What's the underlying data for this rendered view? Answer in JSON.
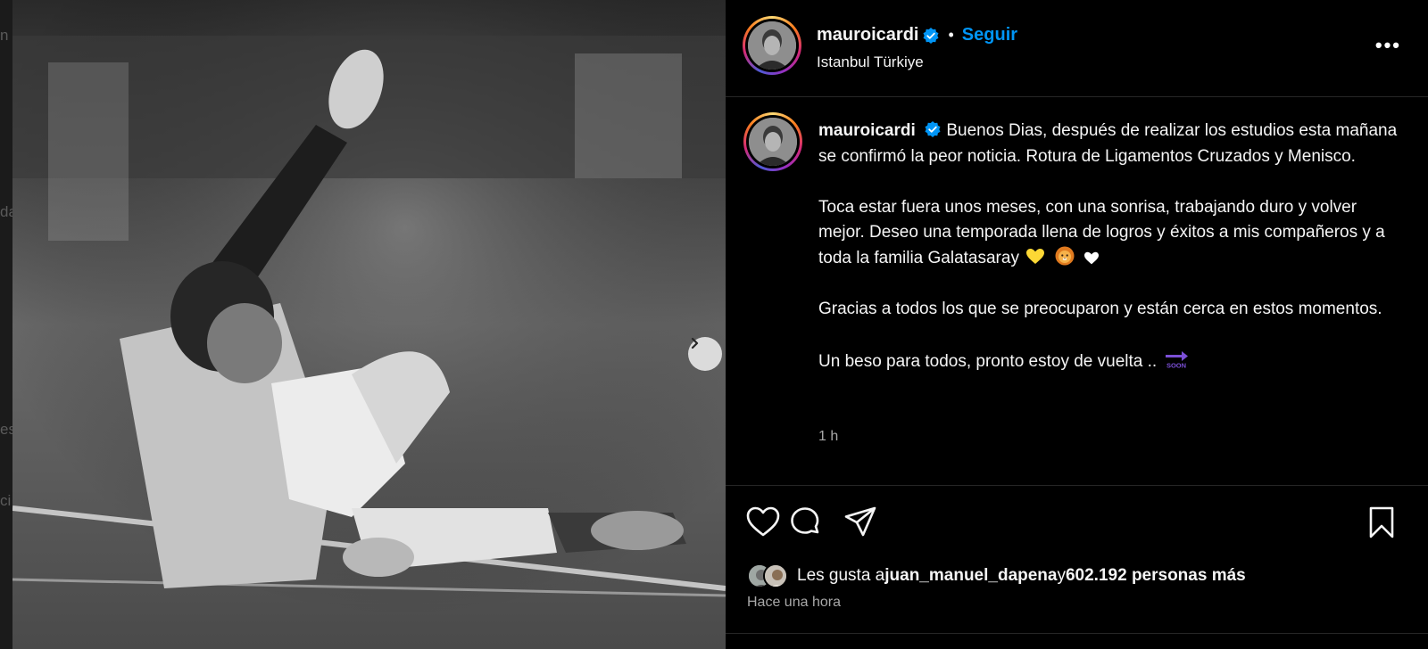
{
  "background_fragments": [
    "n",
    "da",
    "es",
    "ci"
  ],
  "post": {
    "username": "mauroicardi",
    "verified": true,
    "separator": "•",
    "follow_label": "Seguir",
    "location": "Istanbul Türkiye",
    "more_label": "•••",
    "caption_paragraphs": [
      "Buenos Dias, después de realizar los estudios esta mañana se confirmó la peor noticia. Rotura de Ligamentos Cruzados y Menisco.",
      "Toca estar fuera unos meses, con una sonrisa, trabajando duro y volver mejor. Deseo una temporada llena de logros y éxitos a mis compañeros y a toda la familia Galatasaray",
      "Gracias a todos los que se preocuparon y están cerca en estos momentos.",
      "Un beso para todos, pronto estoy de vuelta .."
    ],
    "caption_emojis": [
      "yellow-heart",
      "lion-face",
      "white-heart",
      "soon-arrow"
    ],
    "soon_emoji_label": "SOON",
    "time_ago": "1 h",
    "likes": {
      "prefix": "Les gusta a ",
      "user": "juan_manuel_dapena",
      "middle": " y ",
      "count": "602.192 personas más"
    },
    "posted": "Hace una hora"
  },
  "icons": [
    "heart-icon",
    "comment-icon",
    "share-icon",
    "bookmark-icon",
    "verified-icon",
    "chevron-right-icon",
    "more-icon"
  ],
  "colors": {
    "accent": "#0095f6",
    "verified": "#0095f6",
    "background": "#000000",
    "muted_text": "#a8a8a8"
  }
}
